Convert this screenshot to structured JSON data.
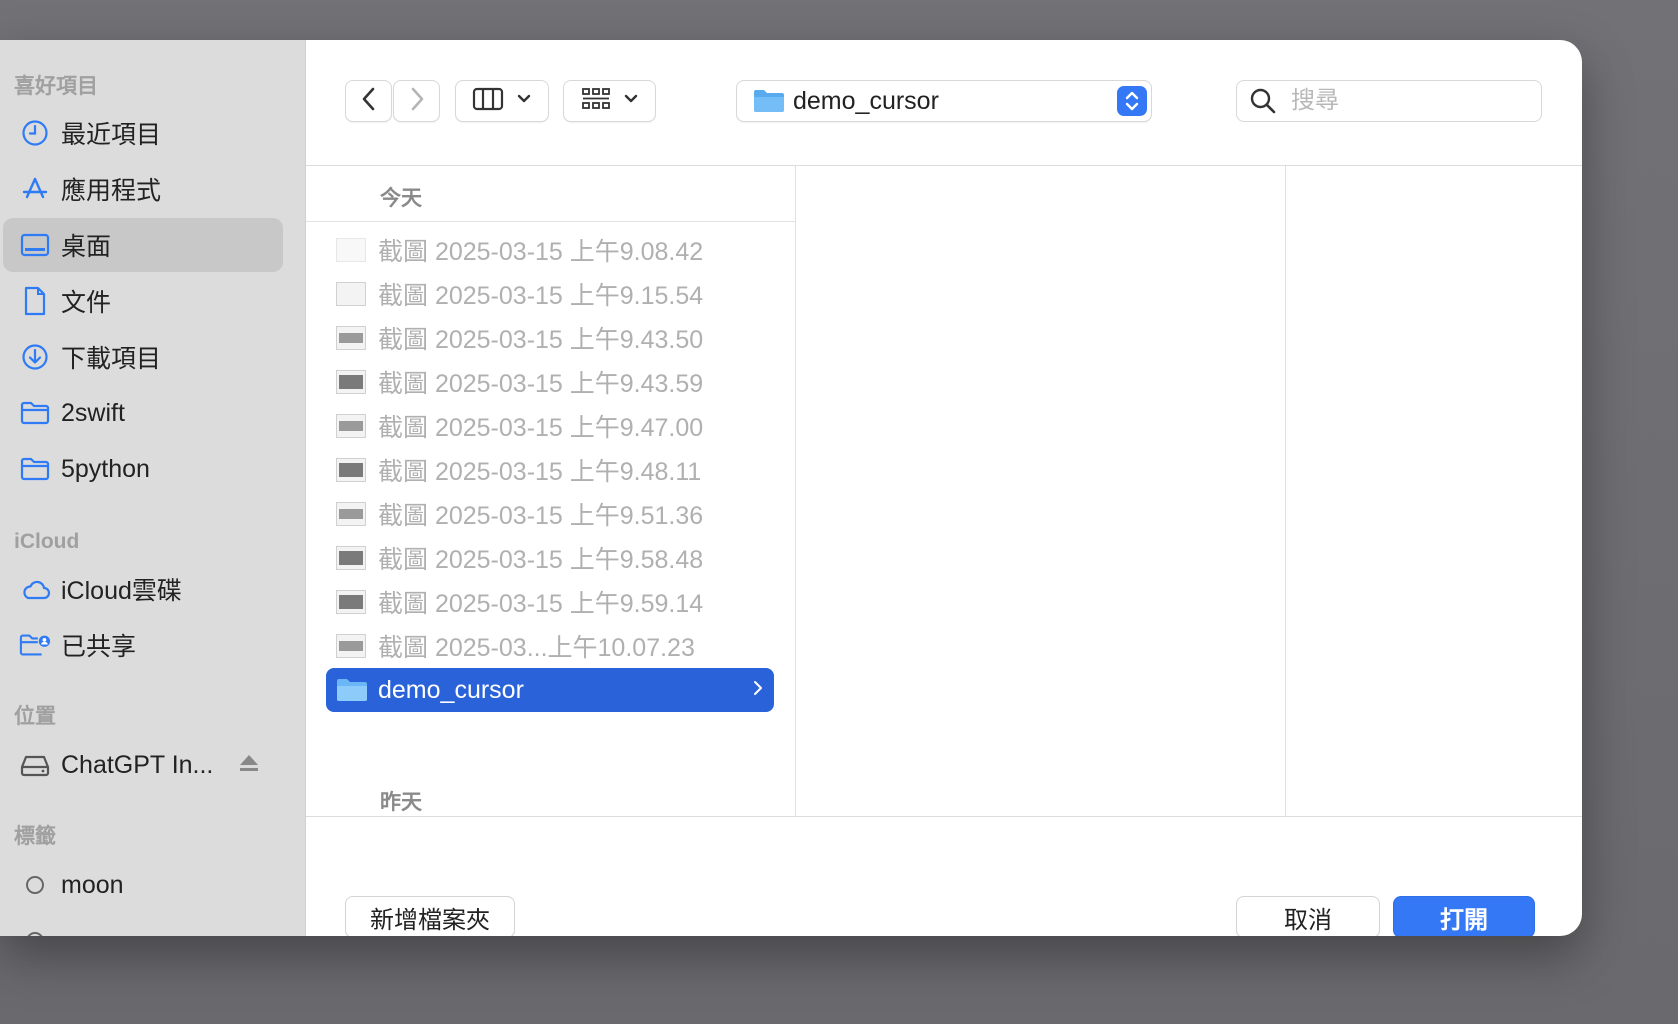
{
  "sidebar": {
    "sections": {
      "favorites": "喜好項目",
      "icloud": "iCloud",
      "locations": "位置",
      "tags": "標籤"
    },
    "favorites": [
      {
        "label": "最近項目",
        "icon": "clock-icon"
      },
      {
        "label": "應用程式",
        "icon": "apps-icon"
      },
      {
        "label": "桌面",
        "icon": "desktop-icon",
        "active": true
      },
      {
        "label": "文件",
        "icon": "document-icon"
      },
      {
        "label": "下載項目",
        "icon": "download-icon"
      },
      {
        "label": "2swift",
        "icon": "folder-icon"
      },
      {
        "label": "5python",
        "icon": "folder-icon"
      }
    ],
    "icloud": [
      {
        "label": "iCloud雲碟",
        "icon": "cloud-icon"
      },
      {
        "label": "已共享",
        "icon": "shared-folder-icon"
      }
    ],
    "locations": [
      {
        "label": "ChatGPT In...",
        "icon": "drive-icon"
      }
    ],
    "tags": [
      {
        "label": "moon",
        "icon": "tag-circle-icon"
      }
    ]
  },
  "toolbar": {
    "path": "demo_cursor",
    "search_placeholder": "搜尋"
  },
  "columns": {
    "today": "今天",
    "yesterday": "昨天",
    "files": [
      "截圖 2025-03-15 上午9.08.42",
      "截圖 2025-03-15 上午9.15.54",
      "截圖 2025-03-15 上午9.43.50",
      "截圖 2025-03-15 上午9.43.59",
      "截圖 2025-03-15 上午9.47.00",
      "截圖 2025-03-15 上午9.48.11",
      "截圖 2025-03-15 上午9.51.36",
      "截圖 2025-03-15 上午9.58.48",
      "截圖 2025-03-15 上午9.59.14",
      "截圖 2025-03...上午10.07.23"
    ],
    "selected_folder": "demo_cursor"
  },
  "footer": {
    "new_folder": "新增檔案夾",
    "cancel": "取消",
    "open": "打開"
  },
  "colors": {
    "accent": "#3478f6",
    "selection": "#2a63d9"
  }
}
